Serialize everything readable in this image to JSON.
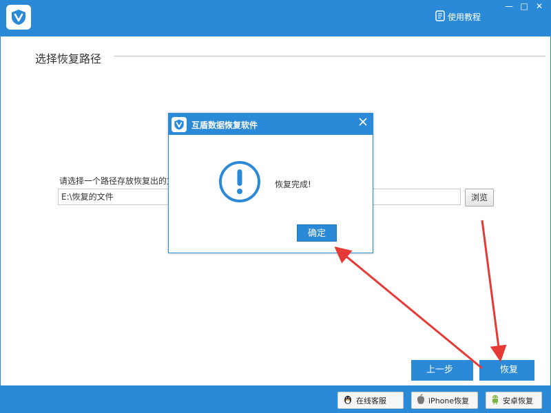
{
  "app": {
    "tutorial_label": "使用教程",
    "window_controls": {
      "minimize": "—",
      "maximize": "□",
      "close": "✕"
    }
  },
  "main": {
    "section_title": "选择恢复路径",
    "path_label": "请选择一个路径存放恢复出的文",
    "path_value": "E:\\恢复的文件",
    "browse_label": "浏览",
    "prev_label": "上一步",
    "next_label": "恢复"
  },
  "footer": {
    "qq_label": "在线客服",
    "iphone_label": "iPhone恢复",
    "android_label": "安卓恢复"
  },
  "dialog": {
    "title": "互盾数据恢复软件",
    "message": "恢复完成!",
    "ok_label": "确定"
  },
  "colors": {
    "accent": "#2a8ad7",
    "annotation_arrow": "#e53935"
  },
  "icons": {
    "app_logo": "shield-v-icon",
    "tutorial": "document-icon",
    "dialog_close": "close-icon",
    "alert": "exclamation-circle-icon",
    "qq": "qq-penguin-icon",
    "iphone": "apple-icon",
    "android": "android-icon"
  }
}
